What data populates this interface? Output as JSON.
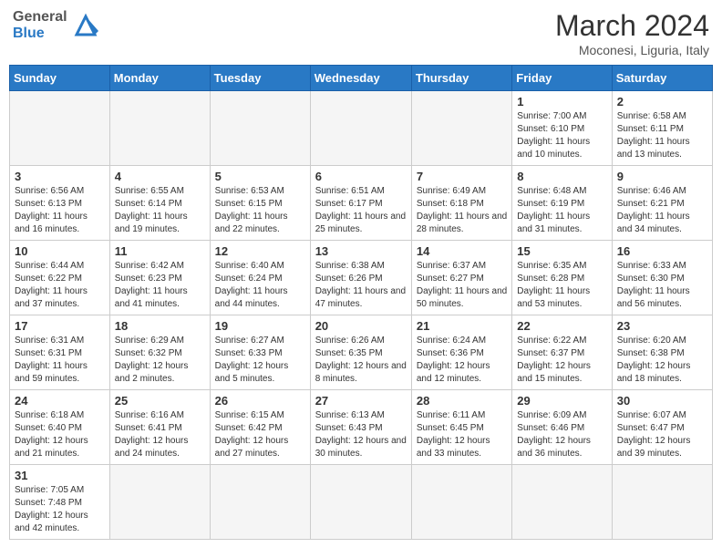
{
  "header": {
    "logo_general": "General",
    "logo_blue": "Blue",
    "month_title": "March 2024",
    "location": "Moconesi, Liguria, Italy"
  },
  "weekdays": [
    "Sunday",
    "Monday",
    "Tuesday",
    "Wednesday",
    "Thursday",
    "Friday",
    "Saturday"
  ],
  "weeks": [
    [
      {
        "day": "",
        "info": ""
      },
      {
        "day": "",
        "info": ""
      },
      {
        "day": "",
        "info": ""
      },
      {
        "day": "",
        "info": ""
      },
      {
        "day": "",
        "info": ""
      },
      {
        "day": "1",
        "info": "Sunrise: 7:00 AM\nSunset: 6:10 PM\nDaylight: 11 hours and 10 minutes."
      },
      {
        "day": "2",
        "info": "Sunrise: 6:58 AM\nSunset: 6:11 PM\nDaylight: 11 hours and 13 minutes."
      }
    ],
    [
      {
        "day": "3",
        "info": "Sunrise: 6:56 AM\nSunset: 6:13 PM\nDaylight: 11 hours and 16 minutes."
      },
      {
        "day": "4",
        "info": "Sunrise: 6:55 AM\nSunset: 6:14 PM\nDaylight: 11 hours and 19 minutes."
      },
      {
        "day": "5",
        "info": "Sunrise: 6:53 AM\nSunset: 6:15 PM\nDaylight: 11 hours and 22 minutes."
      },
      {
        "day": "6",
        "info": "Sunrise: 6:51 AM\nSunset: 6:17 PM\nDaylight: 11 hours and 25 minutes."
      },
      {
        "day": "7",
        "info": "Sunrise: 6:49 AM\nSunset: 6:18 PM\nDaylight: 11 hours and 28 minutes."
      },
      {
        "day": "8",
        "info": "Sunrise: 6:48 AM\nSunset: 6:19 PM\nDaylight: 11 hours and 31 minutes."
      },
      {
        "day": "9",
        "info": "Sunrise: 6:46 AM\nSunset: 6:21 PM\nDaylight: 11 hours and 34 minutes."
      }
    ],
    [
      {
        "day": "10",
        "info": "Sunrise: 6:44 AM\nSunset: 6:22 PM\nDaylight: 11 hours and 37 minutes."
      },
      {
        "day": "11",
        "info": "Sunrise: 6:42 AM\nSunset: 6:23 PM\nDaylight: 11 hours and 41 minutes."
      },
      {
        "day": "12",
        "info": "Sunrise: 6:40 AM\nSunset: 6:24 PM\nDaylight: 11 hours and 44 minutes."
      },
      {
        "day": "13",
        "info": "Sunrise: 6:38 AM\nSunset: 6:26 PM\nDaylight: 11 hours and 47 minutes."
      },
      {
        "day": "14",
        "info": "Sunrise: 6:37 AM\nSunset: 6:27 PM\nDaylight: 11 hours and 50 minutes."
      },
      {
        "day": "15",
        "info": "Sunrise: 6:35 AM\nSunset: 6:28 PM\nDaylight: 11 hours and 53 minutes."
      },
      {
        "day": "16",
        "info": "Sunrise: 6:33 AM\nSunset: 6:30 PM\nDaylight: 11 hours and 56 minutes."
      }
    ],
    [
      {
        "day": "17",
        "info": "Sunrise: 6:31 AM\nSunset: 6:31 PM\nDaylight: 11 hours and 59 minutes."
      },
      {
        "day": "18",
        "info": "Sunrise: 6:29 AM\nSunset: 6:32 PM\nDaylight: 12 hours and 2 minutes."
      },
      {
        "day": "19",
        "info": "Sunrise: 6:27 AM\nSunset: 6:33 PM\nDaylight: 12 hours and 5 minutes."
      },
      {
        "day": "20",
        "info": "Sunrise: 6:26 AM\nSunset: 6:35 PM\nDaylight: 12 hours and 8 minutes."
      },
      {
        "day": "21",
        "info": "Sunrise: 6:24 AM\nSunset: 6:36 PM\nDaylight: 12 hours and 12 minutes."
      },
      {
        "day": "22",
        "info": "Sunrise: 6:22 AM\nSunset: 6:37 PM\nDaylight: 12 hours and 15 minutes."
      },
      {
        "day": "23",
        "info": "Sunrise: 6:20 AM\nSunset: 6:38 PM\nDaylight: 12 hours and 18 minutes."
      }
    ],
    [
      {
        "day": "24",
        "info": "Sunrise: 6:18 AM\nSunset: 6:40 PM\nDaylight: 12 hours and 21 minutes."
      },
      {
        "day": "25",
        "info": "Sunrise: 6:16 AM\nSunset: 6:41 PM\nDaylight: 12 hours and 24 minutes."
      },
      {
        "day": "26",
        "info": "Sunrise: 6:15 AM\nSunset: 6:42 PM\nDaylight: 12 hours and 27 minutes."
      },
      {
        "day": "27",
        "info": "Sunrise: 6:13 AM\nSunset: 6:43 PM\nDaylight: 12 hours and 30 minutes."
      },
      {
        "day": "28",
        "info": "Sunrise: 6:11 AM\nSunset: 6:45 PM\nDaylight: 12 hours and 33 minutes."
      },
      {
        "day": "29",
        "info": "Sunrise: 6:09 AM\nSunset: 6:46 PM\nDaylight: 12 hours and 36 minutes."
      },
      {
        "day": "30",
        "info": "Sunrise: 6:07 AM\nSunset: 6:47 PM\nDaylight: 12 hours and 39 minutes."
      }
    ],
    [
      {
        "day": "31",
        "info": "Sunrise: 7:05 AM\nSunset: 7:48 PM\nDaylight: 12 hours and 42 minutes."
      },
      {
        "day": "",
        "info": ""
      },
      {
        "day": "",
        "info": ""
      },
      {
        "day": "",
        "info": ""
      },
      {
        "day": "",
        "info": ""
      },
      {
        "day": "",
        "info": ""
      },
      {
        "day": "",
        "info": ""
      }
    ]
  ]
}
